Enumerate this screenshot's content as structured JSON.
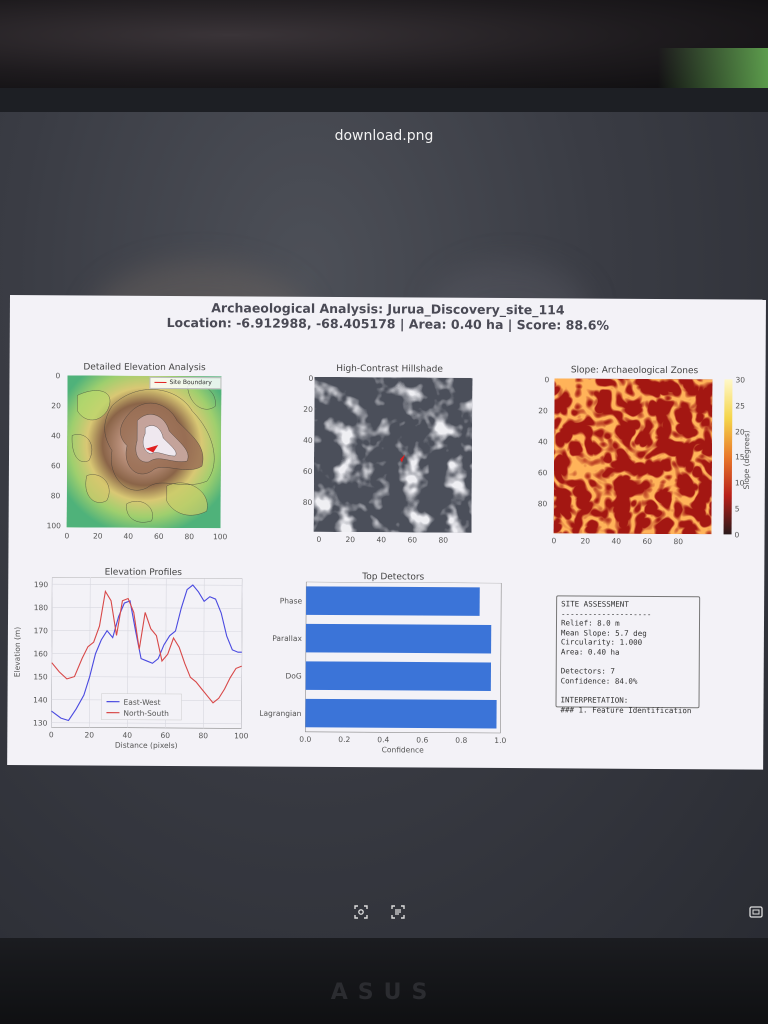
{
  "viewer": {
    "title": "download.png",
    "brand": "ASUS",
    "icons": [
      "lens-icon",
      "text-scan-icon",
      "fullscreen-icon"
    ]
  },
  "figure": {
    "title": "Archaeological Analysis: Jurua_Discovery_site_114",
    "subtitle": "Location: -6.912988, -68.405178 | Area: 0.40 ha | Score: 88.6%"
  },
  "panels": {
    "elevation": {
      "title": "Detailed Elevation Analysis",
      "legend": "Site Boundary",
      "xticks": [
        "0",
        "20",
        "40",
        "60",
        "80",
        "100"
      ],
      "yticks": [
        "0",
        "20",
        "40",
        "60",
        "80",
        "100"
      ]
    },
    "hillshade": {
      "title": "High-Contrast Hillshade",
      "xticks": [
        "0",
        "20",
        "40",
        "60",
        "80"
      ],
      "yticks": [
        "0",
        "20",
        "40",
        "60",
        "80"
      ]
    },
    "slope": {
      "title": "Slope: Archaeological Zones",
      "xticks": [
        "0",
        "20",
        "40",
        "60",
        "80"
      ],
      "yticks": [
        "0",
        "20",
        "40",
        "60",
        "80"
      ],
      "colorbar_label": "Slope (degrees)",
      "colorbar_ticks": [
        "30",
        "25",
        "20",
        "15",
        "10",
        "5",
        "0"
      ]
    }
  },
  "chart_data": [
    {
      "type": "line",
      "title": "Elevation Profiles",
      "xlabel": "Distance (pixels)",
      "ylabel": "Elevation (m)",
      "xlim": [
        0,
        100
      ],
      "ylim": [
        128,
        193
      ],
      "xticks": [
        0,
        20,
        40,
        60,
        80,
        100
      ],
      "yticks": [
        130,
        140,
        150,
        160,
        170,
        180,
        190
      ],
      "grid": true,
      "legend_position": "lower-center",
      "series": [
        {
          "name": "East-West",
          "color": "#4a4ae0",
          "x": [
            0,
            5,
            9,
            13,
            17,
            20,
            23,
            26,
            29,
            32,
            35,
            38,
            41,
            44,
            47,
            50,
            53,
            56,
            59,
            62,
            65,
            68,
            71,
            74,
            77,
            80,
            83,
            86,
            89,
            92,
            95,
            98,
            100
          ],
          "y": [
            135,
            132,
            131,
            136,
            142,
            150,
            160,
            166,
            170,
            167,
            176,
            182,
            183,
            170,
            158,
            157,
            156,
            158,
            164,
            168,
            170,
            180,
            188,
            190,
            187,
            183,
            185,
            184,
            178,
            168,
            162,
            161,
            161
          ]
        },
        {
          "name": "North-South",
          "color": "#d84848",
          "x": [
            0,
            4,
            8,
            12,
            16,
            19,
            22,
            25,
            28,
            31,
            34,
            37,
            40,
            43,
            46,
            49,
            52,
            55,
            58,
            61,
            64,
            67,
            70,
            73,
            76,
            79,
            82,
            85,
            88,
            91,
            94,
            97,
            100
          ],
          "y": [
            156,
            152,
            149,
            150,
            158,
            163,
            165,
            172,
            187,
            183,
            168,
            183,
            184,
            178,
            162,
            178,
            171,
            168,
            157,
            160,
            167,
            163,
            156,
            150,
            148,
            145,
            142,
            139,
            141,
            145,
            150,
            154,
            155
          ]
        }
      ]
    },
    {
      "type": "bar",
      "orientation": "horizontal",
      "title": "Top Detectors",
      "xlabel": "Confidence",
      "xlim": [
        0,
        1.0
      ],
      "xticks": [
        "0.0",
        "0.2",
        "0.4",
        "0.6",
        "0.8",
        "1.0"
      ],
      "categories": [
        "Phase",
        "Parallax",
        "DoG",
        "Lagrangian"
      ],
      "values": [
        0.89,
        0.95,
        0.95,
        0.98
      ],
      "color": "#3b74d8"
    }
  ],
  "assessment": {
    "lines": [
      "SITE ASSESSMENT",
      "--------------------",
      "Relief: 8.0 m",
      "Mean Slope: 5.7 deg",
      "Circularity: 1.000",
      "Area: 0.40 ha",
      "",
      "Detectors: 7",
      "Confidence: 84.0%",
      "",
      "INTERPRETATION:",
      "### 1. Feature Identification"
    ]
  }
}
